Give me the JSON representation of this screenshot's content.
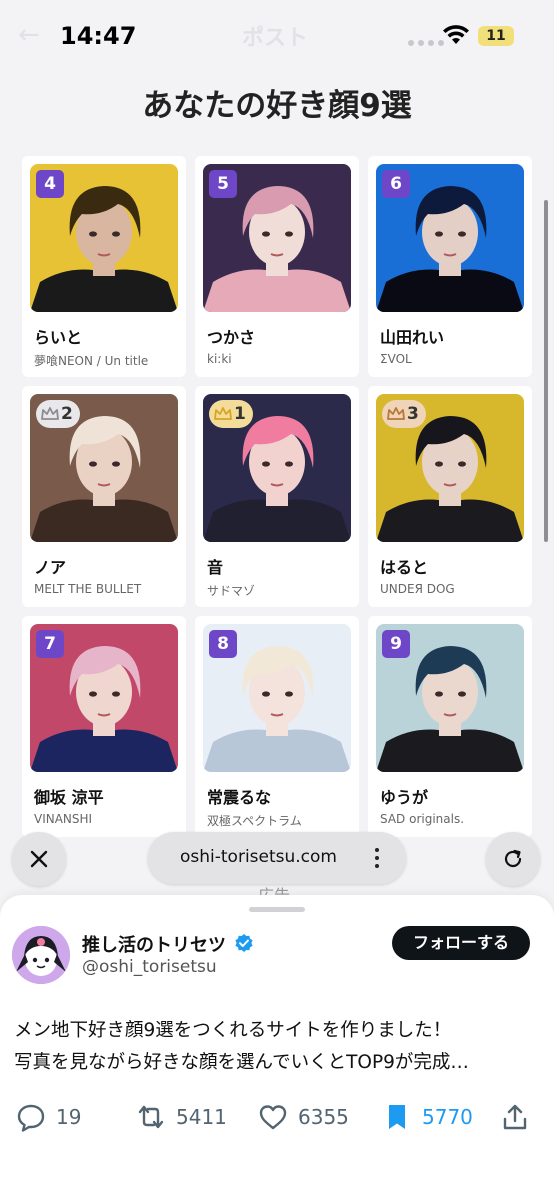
{
  "status_bar": {
    "time": "14:47",
    "battery": "11",
    "behind_back": "←",
    "behind_title": "ポスト",
    "icons": [
      "signal-dots-icon",
      "wifi-icon",
      "battery-icon"
    ]
  },
  "web": {
    "title": "あなたの好き顔9選",
    "cards": [
      {
        "rank": "4",
        "name": "らいと",
        "unit": "夢喰NEON / Un title",
        "crown": false,
        "palette": [
          "#e8c235",
          "#3a2a10",
          "#1a1a1a",
          "#d8b69f"
        ]
      },
      {
        "rank": "5",
        "name": "つかさ",
        "unit": "ki:ki",
        "crown": false,
        "palette": [
          "#3a2b4e",
          "#d89bb0",
          "#e6a9b8",
          "#f0ddd8"
        ]
      },
      {
        "rank": "6",
        "name": "山田れい",
        "unit": "ΣVOL",
        "crown": false,
        "palette": [
          "#1a6fd6",
          "#0d1a3b",
          "#0a0a14",
          "#e4cfc6"
        ]
      },
      {
        "rank": "2",
        "name": "ノア",
        "unit": "MELT THE BULLET",
        "crown": true,
        "crown_color": "#e8e8ea",
        "crown_icon": "silver",
        "palette": [
          "#7a5a4a",
          "#efe3d8",
          "#3a2a22",
          "#e9d2c4"
        ]
      },
      {
        "rank": "1",
        "name": "音",
        "unit": "サドマゾ",
        "crown": true,
        "crown_color": "#f3dc9a",
        "crown_icon": "gold",
        "palette": [
          "#2b2a4a",
          "#f07ca0",
          "#202030",
          "#f1d2cf"
        ]
      },
      {
        "rank": "3",
        "name": "はると",
        "unit": "UNDEЯ DOG",
        "crown": true,
        "crown_color": "#f0d4b8",
        "crown_icon": "bronze",
        "palette": [
          "#d7b82c",
          "#16161c",
          "#1a1a1f",
          "#e6d2c7"
        ]
      },
      {
        "rank": "7",
        "name": "御坂 涼平",
        "unit": "VINANSHI",
        "crown": false,
        "palette": [
          "#c2486a",
          "#e6b5c9",
          "#1d2560",
          "#efd6cf"
        ]
      },
      {
        "rank": "8",
        "name": "常震るな",
        "unit": "双極スペクトラム",
        "crown": false,
        "palette": [
          "#e8eef6",
          "#f1e8d8",
          "#b8c7d8",
          "#f4e3dc"
        ]
      },
      {
        "rank": "9",
        "name": "ゆうが",
        "unit": "SAD originals.",
        "crown": false,
        "palette": [
          "#b9d3d9",
          "#1e3b55",
          "#1a1a1f",
          "#ead8cf"
        ]
      }
    ]
  },
  "browser": {
    "close_icon": "close-icon",
    "url": "oshi-torisetsu.com",
    "more_icon": "more-vertical-icon",
    "reload_icon": "reload-icon",
    "ad_label": "広告"
  },
  "tweet": {
    "author": "推し活のトリセツ",
    "handle": "@oshi_torisetsu",
    "follow_label": "フォローする",
    "text_lines": [
      "メン地下好き顔9選をつくれるサイトを作りました！",
      "写真を見ながら好きな顔を選んでいくとTOP9が完成…"
    ],
    "replies": "19",
    "reposts": "5411",
    "likes": "6355",
    "bookmarks": "5770",
    "accent_color": "#1d9bf0"
  }
}
